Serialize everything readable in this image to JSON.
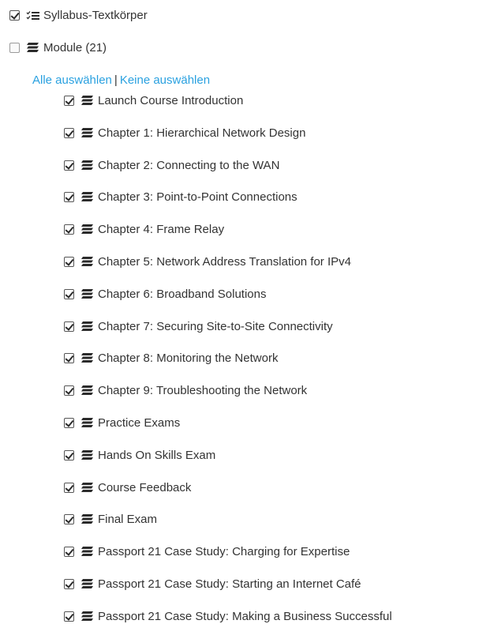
{
  "top": {
    "syllabus": {
      "label": "Syllabus-Textkörper",
      "checked": true
    },
    "modules": {
      "label": "Module (21)",
      "checked": false
    }
  },
  "select_links": {
    "select_all": "Alle auswählen",
    "separator": "|",
    "select_none": "Keine auswählen"
  },
  "module_items": [
    {
      "label": "Launch Course Introduction",
      "checked": true
    },
    {
      "label": "Chapter 1: Hierarchical Network Design",
      "checked": true
    },
    {
      "label": "Chapter 2: Connecting to the WAN",
      "checked": true
    },
    {
      "label": "Chapter 3: Point-to-Point Connections",
      "checked": true
    },
    {
      "label": "Chapter 4: Frame Relay",
      "checked": true
    },
    {
      "label": "Chapter 5: Network Address Translation for IPv4",
      "checked": true
    },
    {
      "label": "Chapter 6: Broadband Solutions",
      "checked": true
    },
    {
      "label": "Chapter 7: Securing Site-to-Site Connectivity",
      "checked": true
    },
    {
      "label": "Chapter 8: Monitoring the Network",
      "checked": true
    },
    {
      "label": "Chapter 9: Troubleshooting the Network",
      "checked": true
    },
    {
      "label": "Practice Exams",
      "checked": true
    },
    {
      "label": "Hands On Skills Exam",
      "checked": true
    },
    {
      "label": "Course Feedback",
      "checked": true
    },
    {
      "label": "Final Exam",
      "checked": true
    },
    {
      "label": "Passport 21 Case Study: Charging for Expertise",
      "checked": true
    },
    {
      "label": "Passport 21 Case Study: Starting an Internet Café",
      "checked": true
    },
    {
      "label": "Passport 21 Case Study: Making a Business Successful",
      "checked": true
    }
  ],
  "icons": {
    "syllabus": "syllabus-list-icon",
    "module": "module-stack-icon"
  },
  "colors": {
    "link": "#2aa1e0",
    "text": "#333333"
  }
}
